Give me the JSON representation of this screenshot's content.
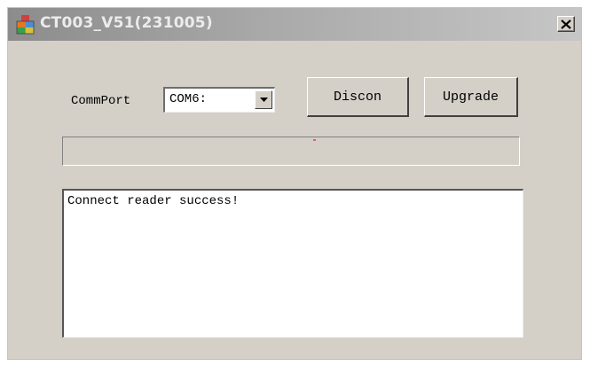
{
  "window": {
    "title": "CT003_V51(231005)",
    "icons": {
      "app": "app-icon",
      "close": "close-icon"
    }
  },
  "comm": {
    "label": "CommPort",
    "selected": "COM6:",
    "dropdown_icon": "chevron-down-icon"
  },
  "buttons": {
    "discon": "Discon",
    "upgrade": "Upgrade"
  },
  "progress": {
    "value_percent": 0
  },
  "log": {
    "text": "Connect reader success!"
  },
  "colors": {
    "titlebar_start": "#8c8c8c",
    "titlebar_end": "#c6c6c6",
    "window_bg": "#d4d0c8",
    "field_bg": "#ffffff"
  }
}
